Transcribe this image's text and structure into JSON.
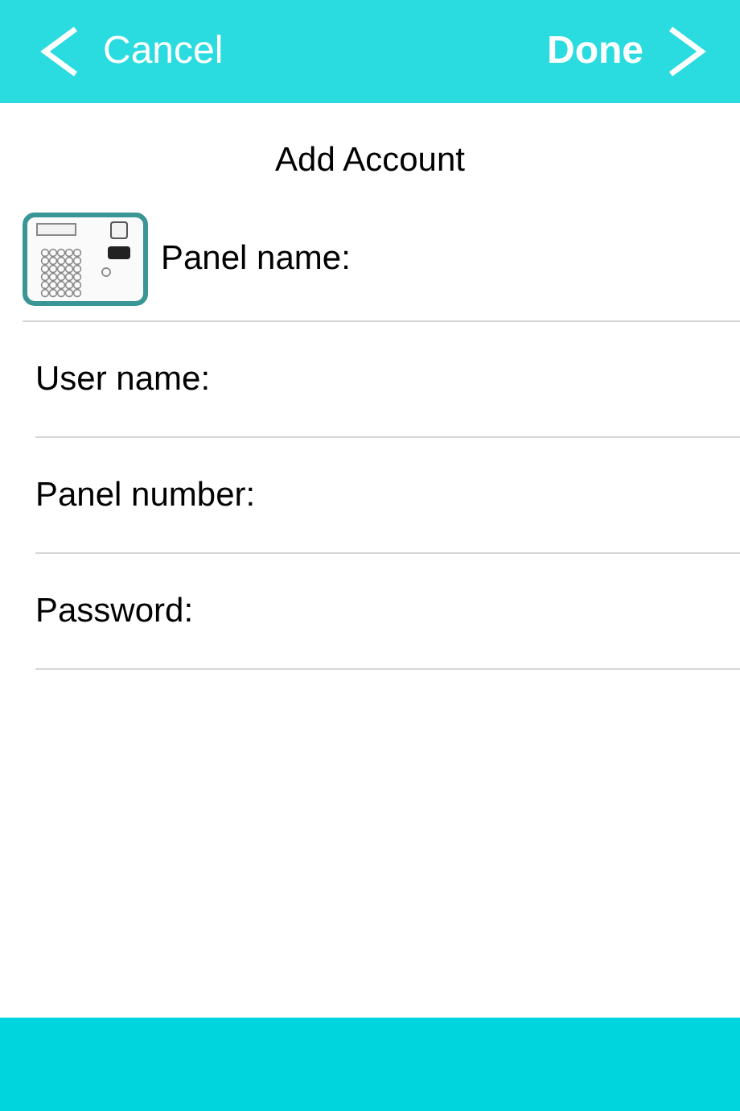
{
  "nav": {
    "cancel": "Cancel",
    "done": "Done"
  },
  "title": "Add Account",
  "fields": [
    {
      "label": "Panel name:",
      "kind": "device"
    },
    {
      "label": "User name:",
      "kind": "plain"
    },
    {
      "label": "Panel number:",
      "kind": "plain"
    },
    {
      "label": "Password:",
      "kind": "plain"
    }
  ]
}
